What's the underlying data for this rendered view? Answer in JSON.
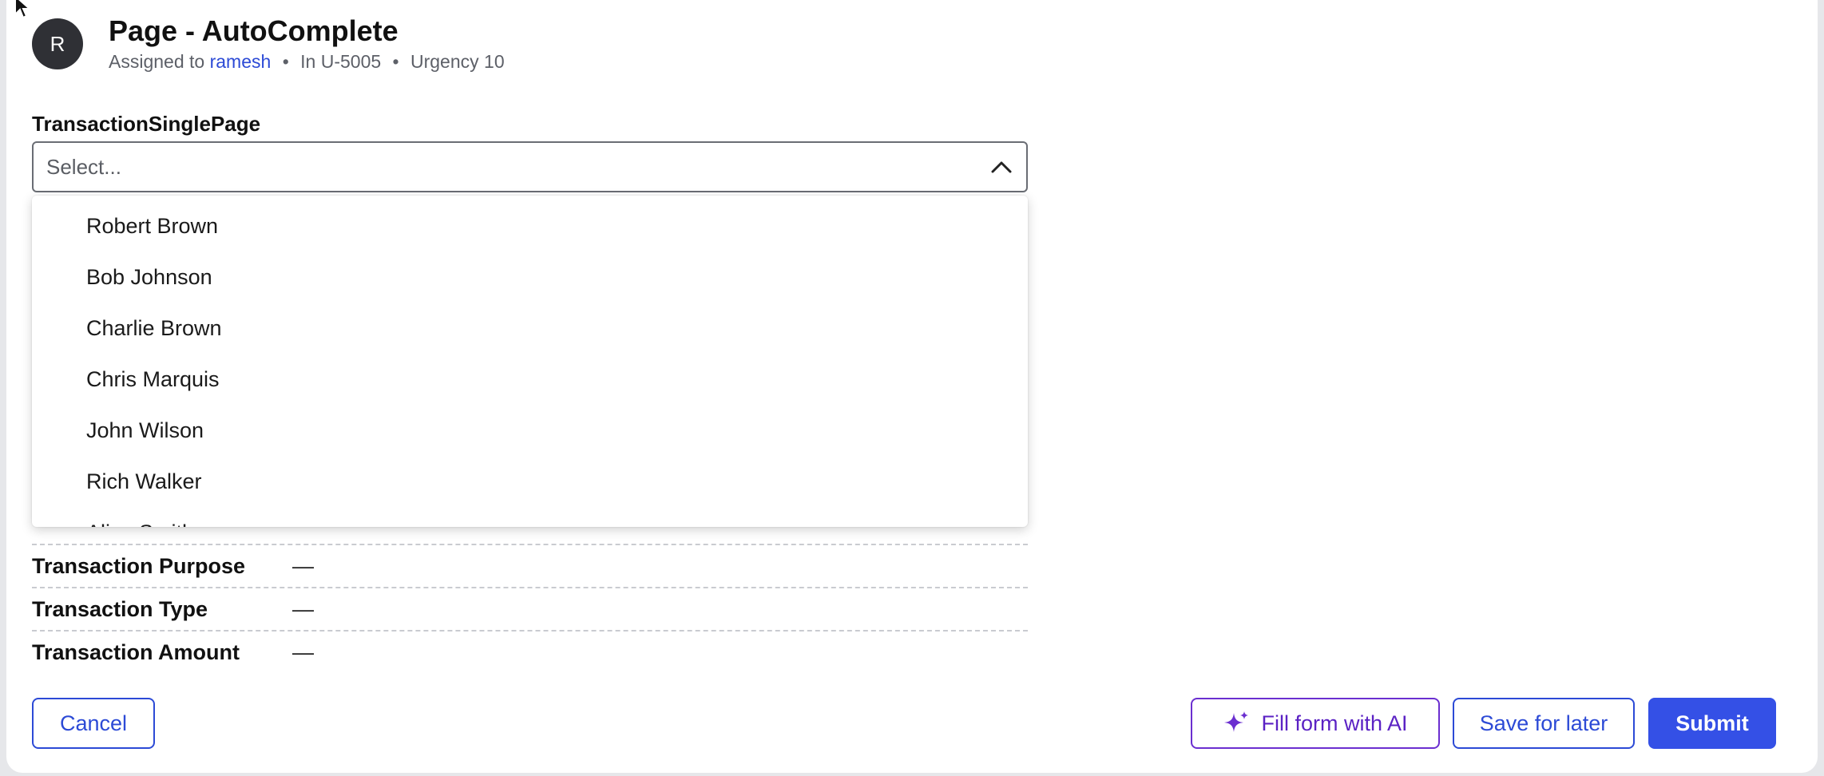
{
  "header": {
    "avatar_initial": "R",
    "title": "Page - AutoComplete",
    "assigned_prefix": "Assigned to",
    "assignee": "ramesh",
    "case_id": "In U-5005",
    "urgency": "Urgency 10",
    "separator": "•"
  },
  "field": {
    "label": "TransactionSinglePage",
    "placeholder": "Select..."
  },
  "dropdown": {
    "options": [
      "Robert Brown",
      "Bob Johnson",
      "Charlie Brown",
      "Chris Marquis",
      "John Wilson",
      "Rich Walker",
      "Alice Smith"
    ]
  },
  "details": [
    {
      "label": "Transaction Purpose",
      "value": "—"
    },
    {
      "label": "Transaction Type",
      "value": "—"
    },
    {
      "label": "Transaction Amount",
      "value": "—"
    }
  ],
  "actions": {
    "cancel": "Cancel",
    "fill_ai": "Fill form with AI",
    "save_later": "Save for later",
    "submit": "Submit"
  },
  "colors": {
    "link": "#2c4ad6",
    "primary": "#3450e6",
    "ai_accent": "#6b2fd0",
    "avatar_bg": "#2f3035"
  },
  "icons": [
    "cursor-arrow-icon",
    "chevron-up-icon",
    "sparkle-icon"
  ]
}
